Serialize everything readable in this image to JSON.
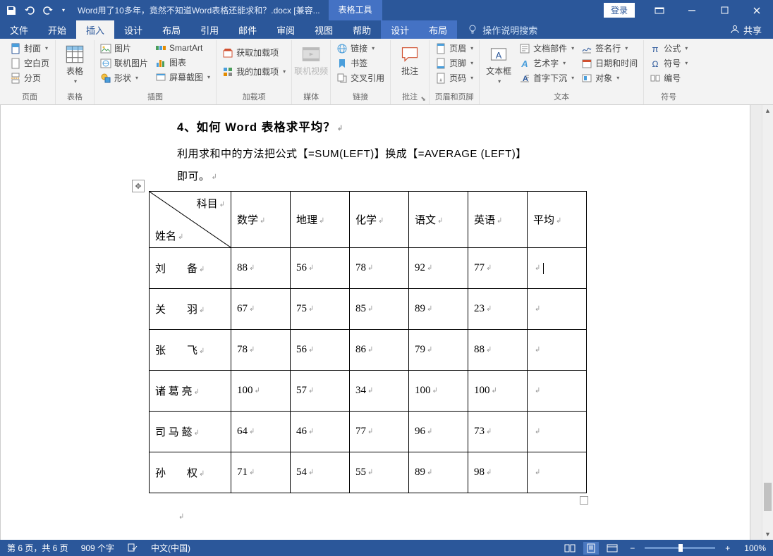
{
  "titlebar": {
    "doc_title": "Word用了10多年，竟然不知道Word表格还能求和？.docx [兼容...",
    "context_label": "表格工具",
    "login": "登录"
  },
  "tabs": {
    "file": "文件",
    "home": "开始",
    "insert": "插入",
    "design": "设计",
    "layout": "布局",
    "ref": "引用",
    "mail": "邮件",
    "review": "审阅",
    "view": "视图",
    "help": "帮助",
    "tbl_design": "设计",
    "tbl_layout": "布局",
    "tell_me": "操作说明搜索",
    "share": "共享"
  },
  "ribbon": {
    "pages": {
      "label": "页面",
      "cover": "封面",
      "blank": "空白页",
      "break": "分页"
    },
    "tables": {
      "label": "表格",
      "table": "表格"
    },
    "illust": {
      "label": "插图",
      "pic": "图片",
      "online_pic": "联机图片",
      "shapes": "形状",
      "smartart": "SmartArt",
      "chart": "图表",
      "screenshot": "屏幕截图"
    },
    "addins": {
      "label": "加载项",
      "get": "获取加载项",
      "my": "我的加载项"
    },
    "media": {
      "label": "媒体",
      "video": "联机视频"
    },
    "links": {
      "label": "链接",
      "link": "链接",
      "bookmark": "书签",
      "cross": "交叉引用"
    },
    "comments": {
      "label": "批注",
      "comment": "批注"
    },
    "hf": {
      "label": "页眉和页脚",
      "header": "页眉",
      "footer": "页脚",
      "page_num": "页码"
    },
    "text": {
      "label": "文本",
      "textbox": "文本框",
      "parts": "文档部件",
      "wordart": "艺术字",
      "dropcap": "首字下沉",
      "sigline": "签名行",
      "datetime": "日期和时间",
      "object": "对象"
    },
    "symbols": {
      "label": "符号",
      "eq": "公式",
      "symbol": "符号",
      "number": "编号"
    }
  },
  "doc": {
    "heading": "4、如何 Word 表格求平均？",
    "para1": "利用求和中的方法把公式【=SUM(LEFT)】换成【=AVERAGE (LEFT)】",
    "para2": "即可。",
    "table": {
      "corner_top": "科目",
      "corner_bottom": "姓名",
      "cols": [
        "数学",
        "地理",
        "化学",
        "语文",
        "英语",
        "平均"
      ],
      "rows": [
        {
          "name": "刘　　备",
          "vals": [
            "88",
            "56",
            "78",
            "92",
            "77",
            ""
          ]
        },
        {
          "name": "关　　羽",
          "vals": [
            "67",
            "75",
            "85",
            "89",
            "23",
            ""
          ]
        },
        {
          "name": "张　　飞",
          "vals": [
            "78",
            "56",
            "86",
            "79",
            "88",
            ""
          ]
        },
        {
          "name": "诸 葛 亮",
          "vals": [
            "100",
            "57",
            "34",
            "100",
            "100",
            ""
          ]
        },
        {
          "name": "司 马 懿",
          "vals": [
            "64",
            "46",
            "77",
            "96",
            "73",
            ""
          ]
        },
        {
          "name": "孙　　权",
          "vals": [
            "71",
            "54",
            "55",
            "89",
            "98",
            ""
          ]
        }
      ]
    }
  },
  "status": {
    "page": "第 6 页，共 6 页",
    "words": "909 个字",
    "lang": "中文(中国)",
    "zoom": "100%"
  }
}
